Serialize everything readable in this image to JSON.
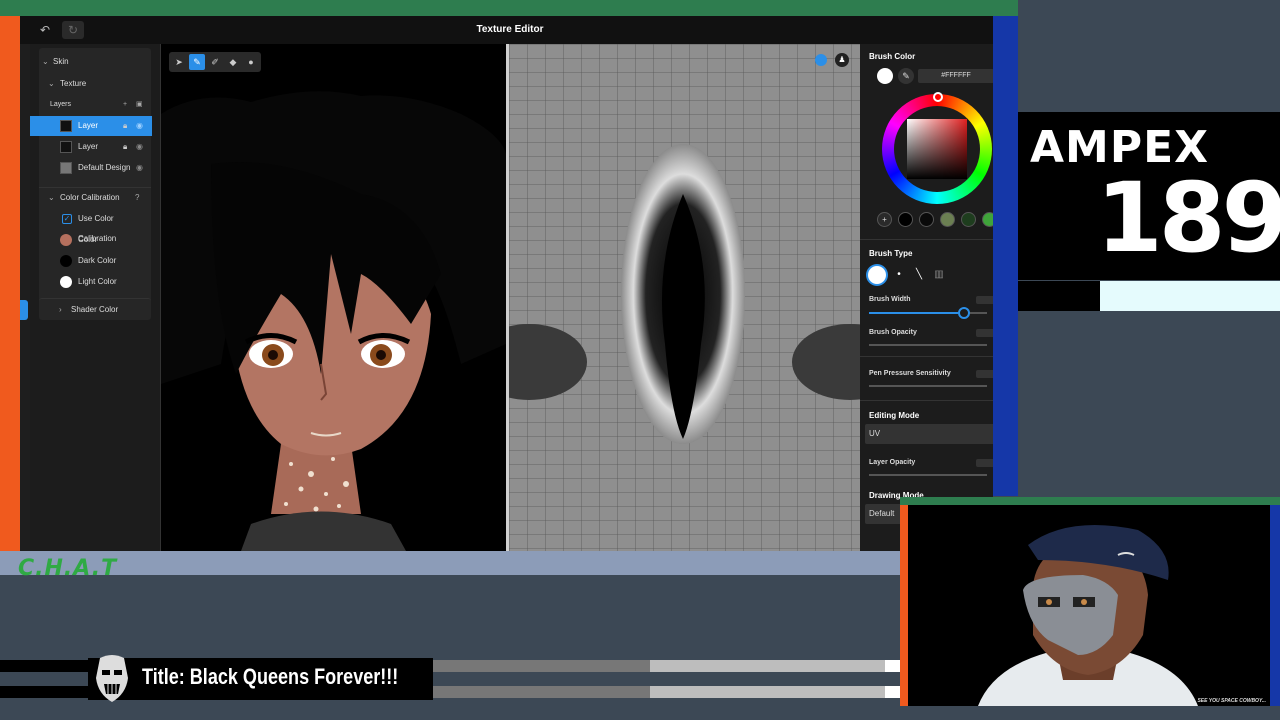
{
  "window": {
    "title": "Texture Editor",
    "undo_icon": "undo-icon",
    "redo_icon": "redo-icon"
  },
  "sidebar": {
    "skin_label": "Skin",
    "texture_label": "Texture",
    "layers_label": "Layers",
    "layers": [
      {
        "label": "Layer",
        "selected": true,
        "locked": true
      },
      {
        "label": "Layer",
        "selected": false,
        "locked": true
      },
      {
        "label": "Default Design",
        "selected": false,
        "locked": false
      }
    ],
    "color_calibration": {
      "title": "Color Calibration",
      "use_label": "Use Color Calibration",
      "use_checked": true,
      "items": [
        {
          "label": "Color",
          "color": "#b5705e"
        },
        {
          "label": "Dark Color",
          "color": "#000000"
        },
        {
          "label": "Light Color",
          "color": "#ffffff"
        }
      ]
    },
    "shader_color_label": "Shader Color"
  },
  "toolbar": {
    "tools": [
      "select-tool-icon",
      "pen-tool-icon",
      "eraser-tool-icon",
      "fill-tool-icon",
      "eyedropper-tool-icon"
    ],
    "active_tool": "pen-tool-icon"
  },
  "properties": {
    "brush_color_label": "Brush Color",
    "brush_color_hex": "#FFFFFF",
    "brush_type_label": "Brush Type",
    "brush_width_label": "Brush Width",
    "brush_width_value": 0.8,
    "brush_opacity_label": "Brush Opacity",
    "pen_pressure_label": "Pen Pressure Sensitivity",
    "editing_mode_label": "Editing Mode",
    "editing_mode_value": "UV",
    "layer_opacity_label": "Layer Opacity",
    "drawing_mode_label": "Drawing Mode",
    "drawing_mode_value": "Default",
    "recent_colors": [
      "#2a2a2a",
      "#000000",
      "#0a0a0a",
      "#6b7f52",
      "#1e3d1e",
      "#3fa43a"
    ]
  },
  "overlay": {
    "ampex_word": "AMPEX",
    "ampex_number": "189",
    "chat_logo": "C.H.A.T",
    "stream_title": "Title: Black Queens Forever!!!",
    "cam_caption": "SEE YOU SPACE COWBOY...",
    "colors": {
      "green": "#2e7d4f",
      "orange": "#f05a1e",
      "blue": "#1537a8",
      "accent": "#2b8fe8"
    }
  }
}
